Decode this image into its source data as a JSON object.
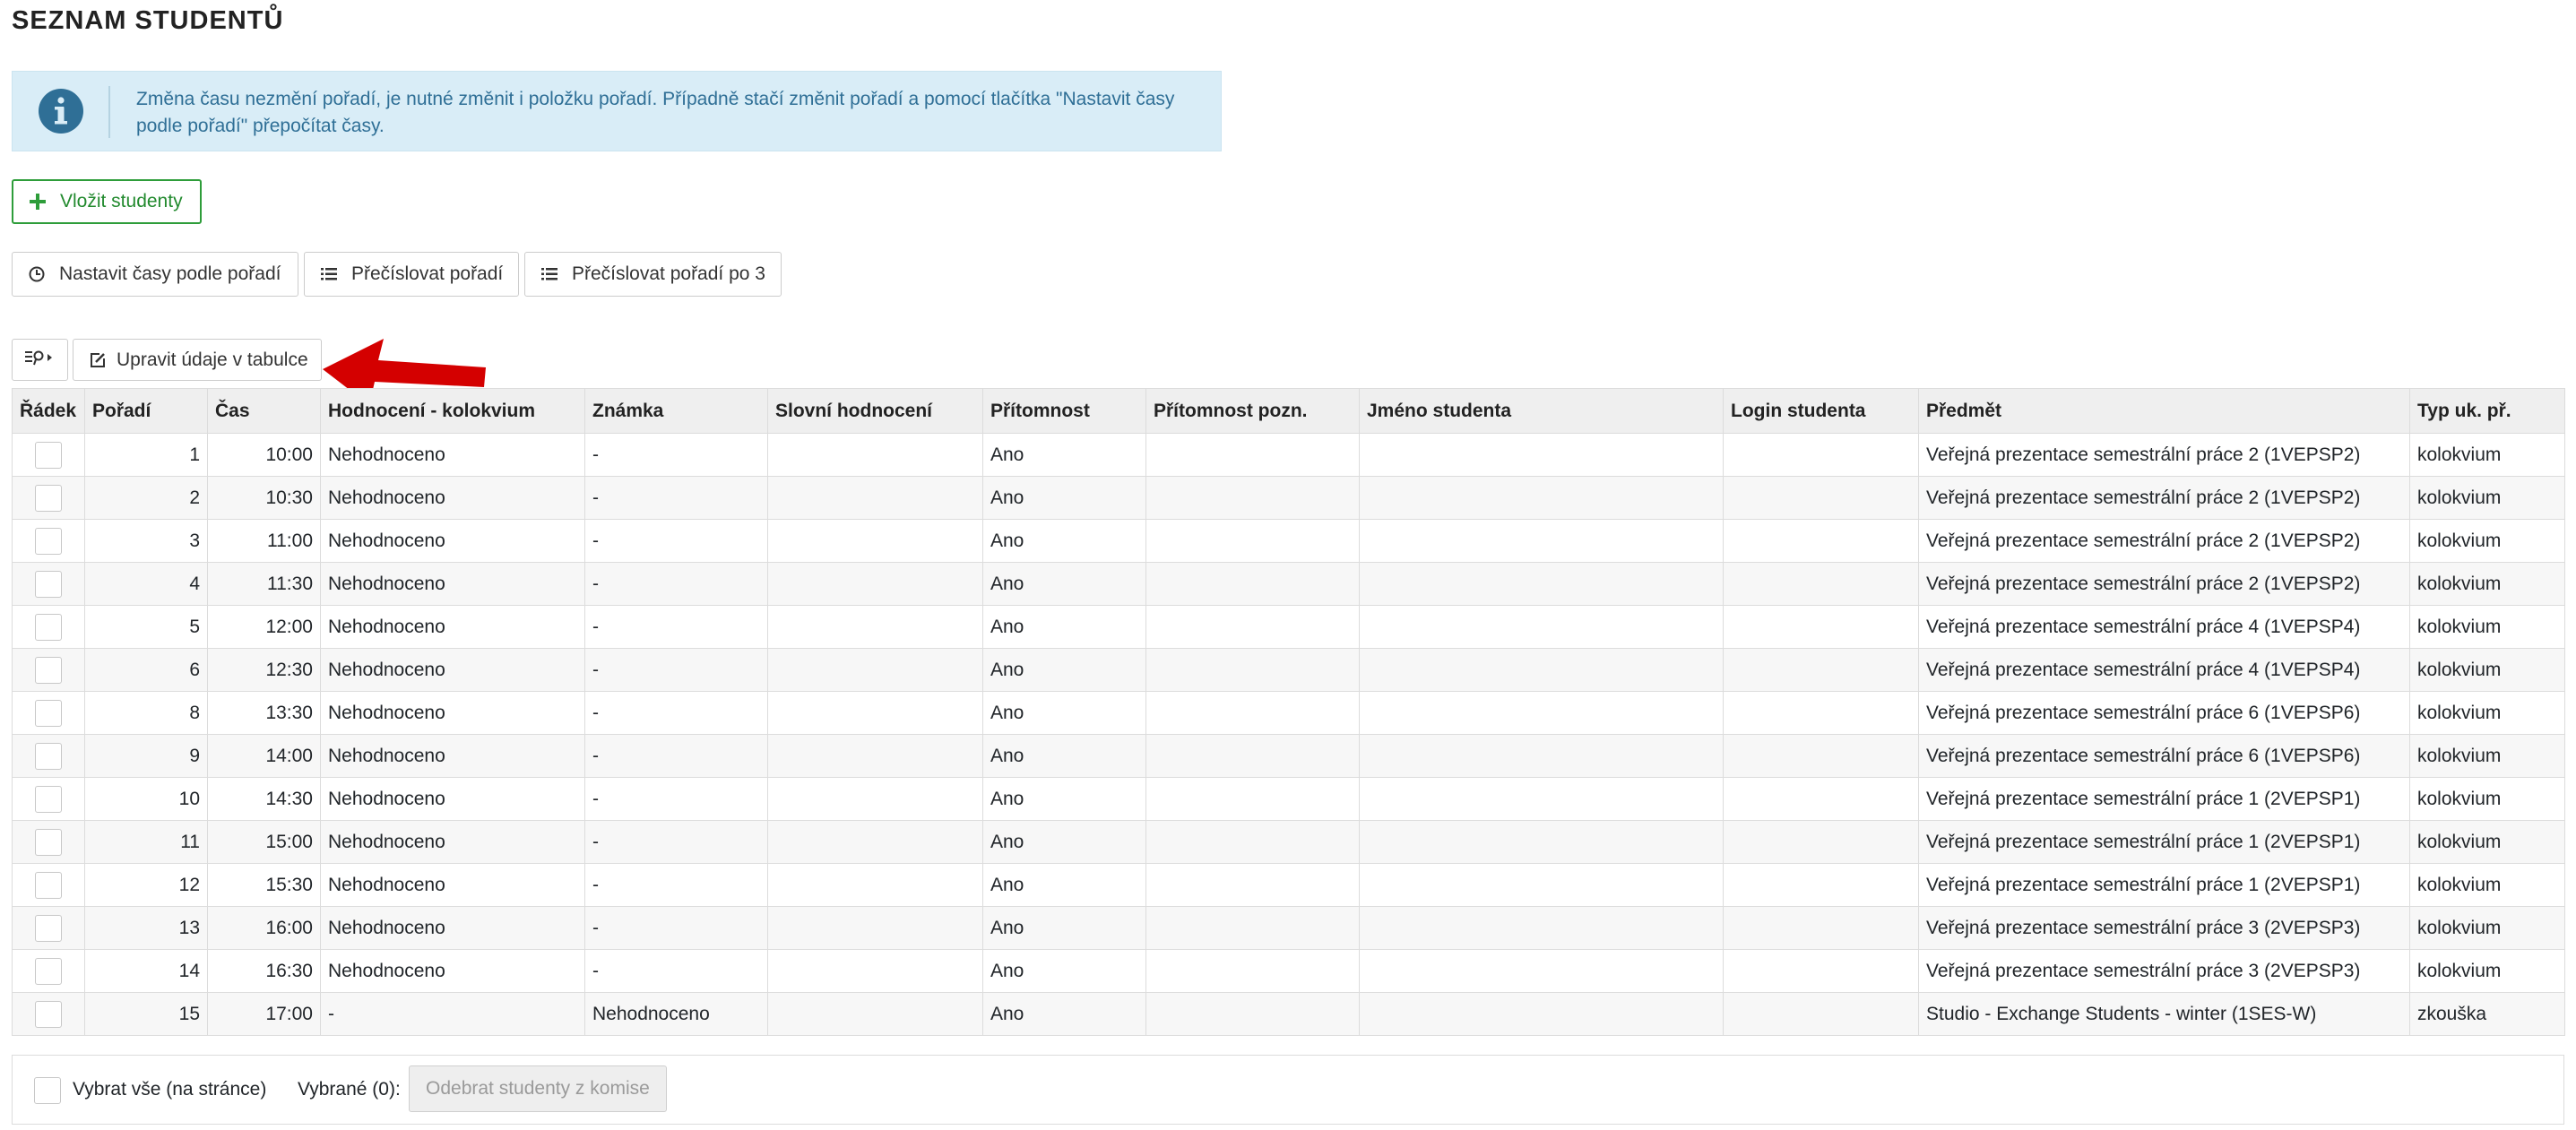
{
  "page": {
    "title": "SEZNAM STUDENTŮ"
  },
  "alert": {
    "icon": "info-icon",
    "text": "Změna času nezmění pořadí, je nutné změnit i položku pořadí. Případně stačí změnit pořadí a pomocí tlačítka \"Nastavit časy podle pořadí\" přepočítat časy."
  },
  "toolbar": {
    "add_students": "Vložit studenty",
    "set_times": "Nastavit časy podle pořadí",
    "renumber": "Přečíslovat pořadí",
    "renumber_by_3": "Přečíslovat pořadí po 3",
    "edit_in_table": "Upravit údaje v tabulce"
  },
  "table": {
    "columns": [
      "Řádek",
      "Pořadí",
      "Čas",
      "Hodnocení - kolokvium",
      "Známka",
      "Slovní hodnocení",
      "Přítomnost",
      "Přítomnost pozn.",
      "Jméno studenta",
      "Login studenta",
      "Předmět",
      "Typ uk. př."
    ],
    "rows": [
      {
        "poradi": "1",
        "cas": "10:00",
        "hodnoceni": "Nehodnoceno",
        "znamka": "-",
        "slovni": "",
        "pritomnost": "Ano",
        "pozn": "",
        "jmeno": "",
        "login": "",
        "predmet": "Veřejná prezentace semestrální práce 2 (1VEPSP2)",
        "typ": "kolokvium"
      },
      {
        "poradi": "2",
        "cas": "10:30",
        "hodnoceni": "Nehodnoceno",
        "znamka": "-",
        "slovni": "",
        "pritomnost": "Ano",
        "pozn": "",
        "jmeno": "",
        "login": "",
        "predmet": "Veřejná prezentace semestrální práce 2 (1VEPSP2)",
        "typ": "kolokvium"
      },
      {
        "poradi": "3",
        "cas": "11:00",
        "hodnoceni": "Nehodnoceno",
        "znamka": "-",
        "slovni": "",
        "pritomnost": "Ano",
        "pozn": "",
        "jmeno": "",
        "login": "",
        "predmet": "Veřejná prezentace semestrální práce 2 (1VEPSP2)",
        "typ": "kolokvium"
      },
      {
        "poradi": "4",
        "cas": "11:30",
        "hodnoceni": "Nehodnoceno",
        "znamka": "-",
        "slovni": "",
        "pritomnost": "Ano",
        "pozn": "",
        "jmeno": "",
        "login": "",
        "predmet": "Veřejná prezentace semestrální práce 2 (1VEPSP2)",
        "typ": "kolokvium"
      },
      {
        "poradi": "5",
        "cas": "12:00",
        "hodnoceni": "Nehodnoceno",
        "znamka": "-",
        "slovni": "",
        "pritomnost": "Ano",
        "pozn": "",
        "jmeno": "",
        "login": "",
        "predmet": "Veřejná prezentace semestrální práce 4 (1VEPSP4)",
        "typ": "kolokvium"
      },
      {
        "poradi": "6",
        "cas": "12:30",
        "hodnoceni": "Nehodnoceno",
        "znamka": "-",
        "slovni": "",
        "pritomnost": "Ano",
        "pozn": "",
        "jmeno": "",
        "login": "",
        "predmet": "Veřejná prezentace semestrální práce 4 (1VEPSP4)",
        "typ": "kolokvium"
      },
      {
        "poradi": "8",
        "cas": "13:30",
        "hodnoceni": "Nehodnoceno",
        "znamka": "-",
        "slovni": "",
        "pritomnost": "Ano",
        "pozn": "",
        "jmeno": "",
        "login": "",
        "predmet": "Veřejná prezentace semestrální práce 6 (1VEPSP6)",
        "typ": "kolokvium"
      },
      {
        "poradi": "9",
        "cas": "14:00",
        "hodnoceni": "Nehodnoceno",
        "znamka": "-",
        "slovni": "",
        "pritomnost": "Ano",
        "pozn": "",
        "jmeno": "",
        "login": "",
        "predmet": "Veřejná prezentace semestrální práce 6 (1VEPSP6)",
        "typ": "kolokvium"
      },
      {
        "poradi": "10",
        "cas": "14:30",
        "hodnoceni": "Nehodnoceno",
        "znamka": "-",
        "slovni": "",
        "pritomnost": "Ano",
        "pozn": "",
        "jmeno": "",
        "login": "",
        "predmet": "Veřejná prezentace semestrální práce 1 (2VEPSP1)",
        "typ": "kolokvium"
      },
      {
        "poradi": "11",
        "cas": "15:00",
        "hodnoceni": "Nehodnoceno",
        "znamka": "-",
        "slovni": "",
        "pritomnost": "Ano",
        "pozn": "",
        "jmeno": "",
        "login": "",
        "predmet": "Veřejná prezentace semestrální práce 1 (2VEPSP1)",
        "typ": "kolokvium"
      },
      {
        "poradi": "12",
        "cas": "15:30",
        "hodnoceni": "Nehodnoceno",
        "znamka": "-",
        "slovni": "",
        "pritomnost": "Ano",
        "pozn": "",
        "jmeno": "",
        "login": "",
        "predmet": "Veřejná prezentace semestrální práce 1 (2VEPSP1)",
        "typ": "kolokvium"
      },
      {
        "poradi": "13",
        "cas": "16:00",
        "hodnoceni": "Nehodnoceno",
        "znamka": "-",
        "slovni": "",
        "pritomnost": "Ano",
        "pozn": "",
        "jmeno": "",
        "login": "",
        "predmet": "Veřejná prezentace semestrální práce 3 (2VEPSP3)",
        "typ": "kolokvium"
      },
      {
        "poradi": "14",
        "cas": "16:30",
        "hodnoceni": "Nehodnoceno",
        "znamka": "-",
        "slovni": "",
        "pritomnost": "Ano",
        "pozn": "",
        "jmeno": "",
        "login": "",
        "predmet": "Veřejná prezentace semestrální práce 3 (2VEPSP3)",
        "typ": "kolokvium"
      },
      {
        "poradi": "15",
        "cas": "17:00",
        "hodnoceni": "-",
        "znamka": "Nehodnoceno",
        "slovni": "",
        "pritomnost": "Ano",
        "pozn": "",
        "jmeno": "",
        "login": "",
        "predmet": "Studio - Exchange Students - winter (1SES-W)",
        "typ": "zkouška"
      }
    ]
  },
  "footer": {
    "select_all": "Vybrat vše (na stránce)",
    "selected": "Vybrané (0):",
    "remove_button": "Odebrat studenty z komise"
  },
  "colors": {
    "alert_bg": "#d9edf7",
    "info_icon": "#2f6f96",
    "accent_green": "#2e9d3a",
    "arrow_red": "#d40000"
  }
}
